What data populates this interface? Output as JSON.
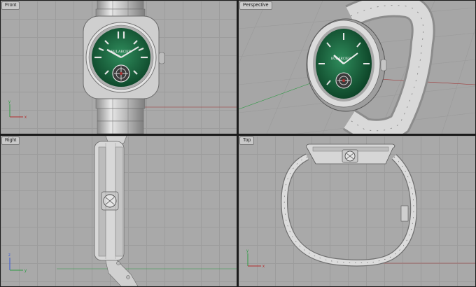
{
  "viewports": {
    "front": {
      "label": "Front"
    },
    "perspective": {
      "label": "Perspective"
    },
    "right": {
      "label": "Right"
    },
    "top": {
      "label": "Top"
    }
  },
  "axes": {
    "x": "x",
    "y": "y",
    "z": "z"
  },
  "watch": {
    "brand": "BULARCIER"
  },
  "colors": {
    "dial_green": "#1f6b45",
    "steel": "#d4d4d4",
    "x_axis": "#b22a2a",
    "y_axis": "#2e9a44",
    "z_axis": "#3355d6"
  }
}
